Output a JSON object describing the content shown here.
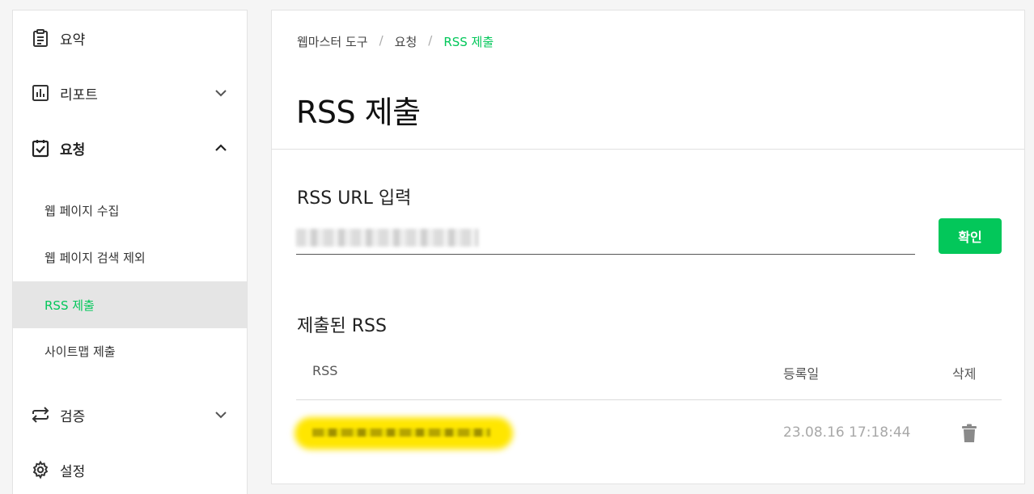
{
  "sidebar": {
    "items": [
      {
        "label": "요약",
        "icon": "clipboard-icon"
      },
      {
        "label": "리포트",
        "icon": "bar-chart-icon"
      },
      {
        "label": "요청",
        "icon": "clipboard-check-icon"
      },
      {
        "label": "검증",
        "icon": "swap-arrows-icon"
      },
      {
        "label": "설정",
        "icon": "gear-icon"
      }
    ],
    "subitems": [
      {
        "label": "웹 페이지 수집"
      },
      {
        "label": "웹 페이지 검색 제외"
      },
      {
        "label": "RSS 제출"
      },
      {
        "label": "사이트맵 제출"
      }
    ]
  },
  "breadcrumb": {
    "items": [
      "웹마스터 도구",
      "요청",
      "RSS 제출"
    ],
    "separator": "/"
  },
  "page": {
    "title": "RSS 제출"
  },
  "input_section": {
    "title": "RSS URL 입력",
    "confirm_label": "확인"
  },
  "submitted": {
    "title": "제출된 RSS",
    "headers": [
      "RSS",
      "등록일",
      "삭제"
    ],
    "rows": [
      {
        "date": "23.08.16 17:18:44"
      }
    ]
  },
  "colors": {
    "accent": "#03c75a",
    "highlight": "#ffe600"
  }
}
